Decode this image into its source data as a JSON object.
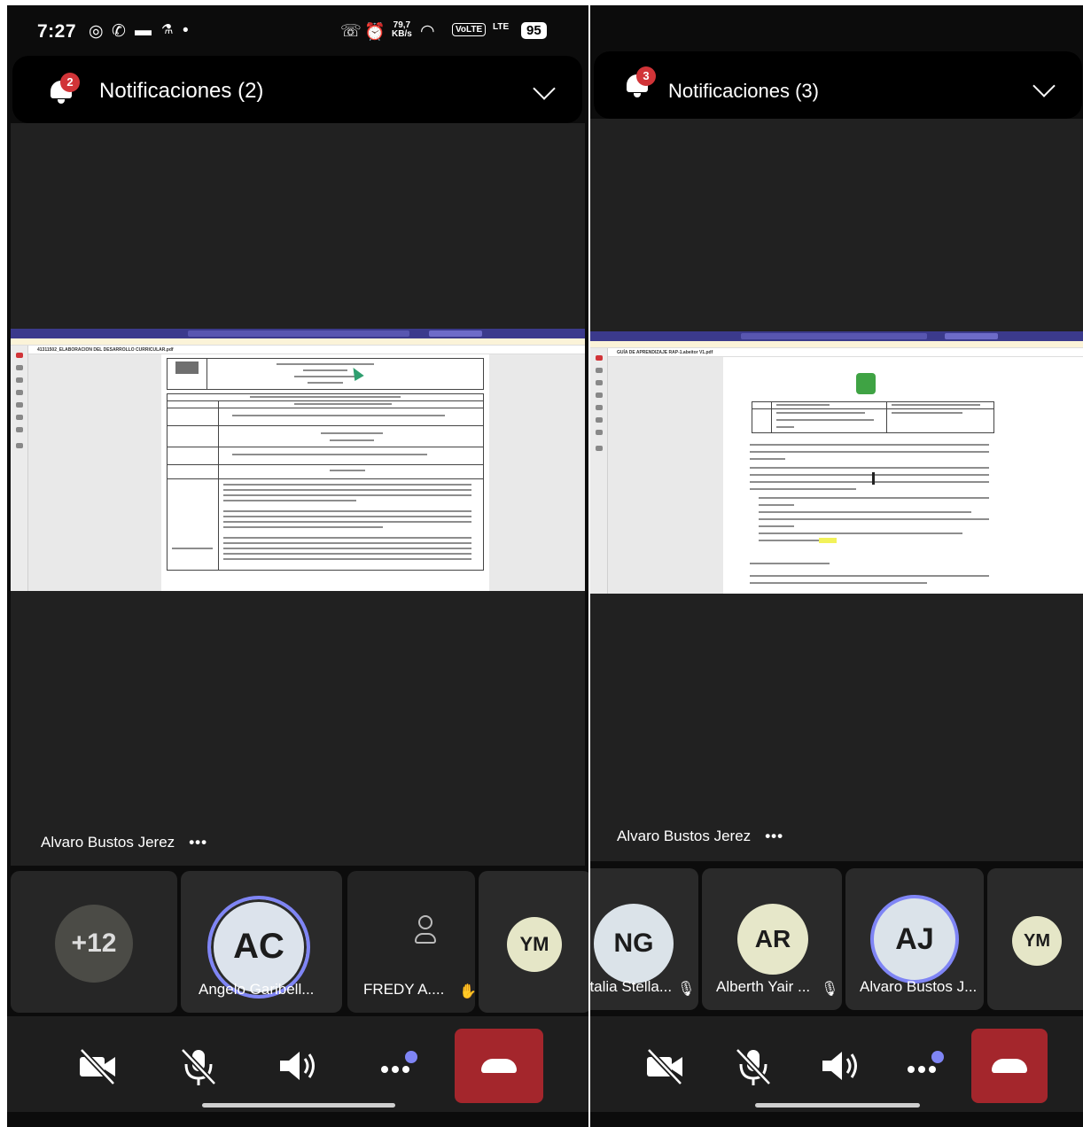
{
  "left": {
    "status": {
      "time": "7:27",
      "speed": "79,7",
      "speed_unit": "KB/s",
      "volte": "VoLTE",
      "lte": "LTE",
      "battery": "95"
    },
    "notifications": {
      "label": "Notificaciones (2)",
      "count": "2"
    },
    "share": {
      "filename": "41311502_ELABORACION DEL DESARROLLO CURRICULAR.pdf"
    },
    "speaker": {
      "name": "Alvaro Bustos Jerez",
      "more": "•••"
    },
    "tiles": [
      {
        "initials": "+12",
        "name": ""
      },
      {
        "initials": "AC",
        "name": "Angelo Garibell..."
      },
      {
        "initials": "",
        "name": "FREDY A...."
      },
      {
        "initials": "YM",
        "name": ""
      }
    ]
  },
  "right": {
    "notifications": {
      "label": "Notificaciones (3)",
      "count": "3"
    },
    "share": {
      "filename": "GUÍA DE APRENDIZAJE RAP-1.abeitor V1.pdf"
    },
    "speaker": {
      "name": "Alvaro Bustos Jerez",
      "more": "•••"
    },
    "tiles": [
      {
        "initials": "NG",
        "name": "atalia Stella..."
      },
      {
        "initials": "AR",
        "name": "Alberth Yair ..."
      },
      {
        "initials": "AJ",
        "name": "Alvaro Bustos J..."
      },
      {
        "initials": "YM",
        "name": ""
      }
    ]
  },
  "colors": {
    "hangup": "#a4262c",
    "badge": "#d13438",
    "accent": "#7f85f5"
  },
  "icons": [
    "bell-icon",
    "chevron-down-icon",
    "camera-off-icon",
    "mic-off-icon",
    "speaker-icon",
    "more-icon",
    "hangup-icon",
    "person-icon"
  ]
}
